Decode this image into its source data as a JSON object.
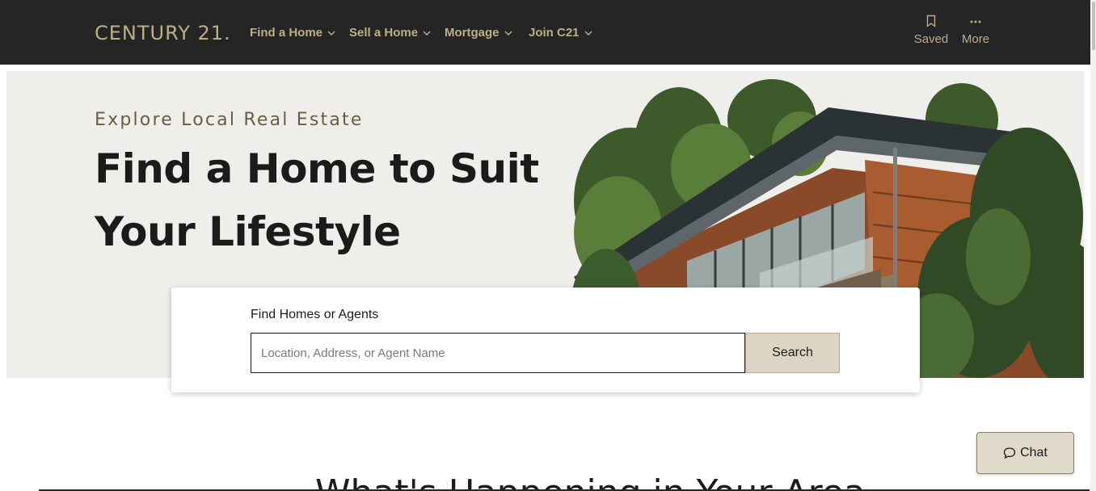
{
  "header": {
    "logo": "CENTURY 21.",
    "nav": [
      {
        "label": "Find a Home"
      },
      {
        "label": "Sell a Home"
      },
      {
        "label": "Mortgage"
      },
      {
        "label": "Join C21"
      }
    ],
    "saved_label": "Saved",
    "more_label": "More"
  },
  "hero": {
    "eyebrow": "Explore Local Real Estate",
    "title": "Find a Home to Suit Your Lifestyle"
  },
  "search": {
    "label": "Find Homes or Agents",
    "placeholder": "Location, Address, or Agent Name",
    "value": "",
    "button": "Search"
  },
  "section": {
    "heading": "What's Happening in Your Area"
  },
  "chat": {
    "label": "Chat"
  },
  "colors": {
    "header_bg": "#252526",
    "brand_gold": "#beae88",
    "hero_bg": "#efeeeb",
    "search_button_bg": "#dcd5c4"
  },
  "icons": {
    "bookmark": "bookmark-icon",
    "more": "ellipsis-icon",
    "chevron": "chevron-down-icon",
    "chat": "chat-bubble-icon"
  }
}
